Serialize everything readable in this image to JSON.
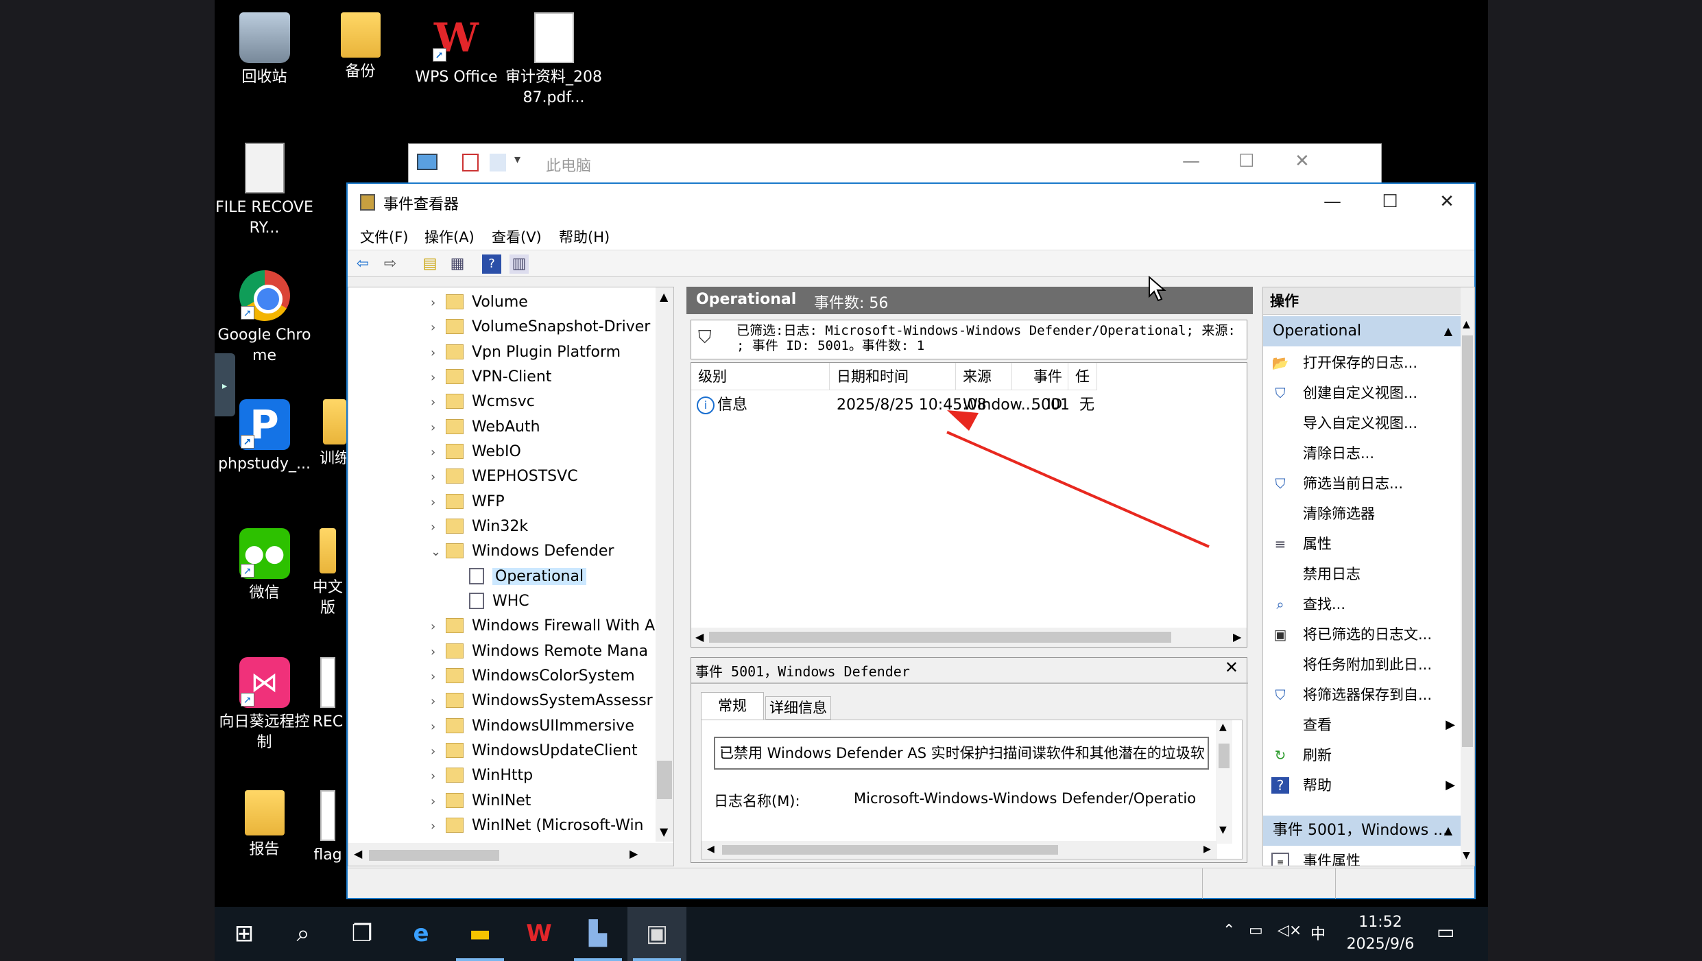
{
  "desktop": {
    "icons": [
      {
        "label": "回收站",
        "icon": "recycle-bin-icon"
      },
      {
        "label": "备份",
        "icon": "folder-icon"
      },
      {
        "label": "WPS Office",
        "icon": "wps-icon"
      },
      {
        "label": "审计资料_20887.pdf...",
        "icon": "document-icon"
      },
      {
        "label": "FILE RECOVERY...",
        "icon": "document-icon"
      },
      {
        "label": "Google Chrome",
        "icon": "chrome-icon"
      },
      {
        "label": "phpstudy_...",
        "icon": "phpstudy-icon"
      },
      {
        "label": "训练",
        "icon": "folder-icon"
      },
      {
        "label": "微信",
        "icon": "wechat-icon"
      },
      {
        "label": "中文版",
        "icon": "folder-icon"
      },
      {
        "label": "向日葵远程控制",
        "icon": "sunlogin-icon"
      },
      {
        "label": "REC",
        "icon": "document-icon"
      },
      {
        "label": "报告",
        "icon": "folder-icon"
      },
      {
        "label": "flag",
        "icon": "document-icon"
      }
    ]
  },
  "explorer": {
    "title": "此电脑"
  },
  "eventviewer": {
    "title": "事件查看器",
    "menu": [
      "文件(F)",
      "操作(A)",
      "查看(V)",
      "帮助(H)"
    ],
    "tree": [
      {
        "label": "Volume",
        "type": "folder",
        "expanded": false
      },
      {
        "label": "VolumeSnapshot-Driver",
        "type": "folder",
        "expanded": false
      },
      {
        "label": "Vpn Plugin Platform",
        "type": "folder",
        "expanded": false
      },
      {
        "label": "VPN-Client",
        "type": "folder",
        "expanded": false
      },
      {
        "label": "Wcmsvc",
        "type": "folder",
        "expanded": false
      },
      {
        "label": "WebAuth",
        "type": "folder",
        "expanded": false
      },
      {
        "label": "WebIO",
        "type": "folder",
        "expanded": false
      },
      {
        "label": "WEPHOSTSVC",
        "type": "folder",
        "expanded": false
      },
      {
        "label": "WFP",
        "type": "folder",
        "expanded": false
      },
      {
        "label": "Win32k",
        "type": "folder",
        "expanded": false
      },
      {
        "label": "Windows Defender",
        "type": "folder",
        "expanded": true
      },
      {
        "label": "Operational",
        "type": "log",
        "selected": true
      },
      {
        "label": "WHC",
        "type": "log"
      },
      {
        "label": "Windows Firewall With A",
        "type": "folder",
        "expanded": false
      },
      {
        "label": "Windows Remote Mana",
        "type": "folder",
        "expanded": false
      },
      {
        "label": "WindowsColorSystem",
        "type": "folder",
        "expanded": false
      },
      {
        "label": "WindowsSystemAssessr",
        "type": "folder",
        "expanded": false
      },
      {
        "label": "WindowsUIImmersive",
        "type": "folder",
        "expanded": false
      },
      {
        "label": "WindowsUpdateClient",
        "type": "folder",
        "expanded": false
      },
      {
        "label": "WinHttp",
        "type": "folder",
        "expanded": false
      },
      {
        "label": "WinINet",
        "type": "folder",
        "expanded": false
      },
      {
        "label": "WinINet (Microsoft-Win",
        "type": "folder",
        "expanded": false
      }
    ],
    "log_header": {
      "name": "Operational",
      "count": "事件数: 56"
    },
    "filter_line1": "已筛选:日志: Microsoft-Windows-Windows Defender/Operational; 来源:",
    "filter_line2": "; 事件 ID: 5001。事件数: 1",
    "columns": [
      "级别",
      "日期和时间",
      "来源",
      "事件 ID",
      "任务类"
    ],
    "rows": [
      {
        "level": "信息",
        "datetime": "2025/8/25 10:45:08",
        "source": "Window...",
        "event_id": "5001",
        "task": "无"
      }
    ],
    "detail": {
      "title": "事件 5001，Windows Defender",
      "tabs": [
        "常规",
        "详细信息"
      ],
      "message": "已禁用 Windows Defender AS 实时保护扫描间谍软件和其他潜在的垃圾软",
      "log_name_label": "日志名称(M):",
      "log_name_value": "Microsoft-Windows-Windows Defender/Operatio"
    },
    "actions_title": "操作",
    "action_section1": "Operational",
    "actions": [
      {
        "label": "打开保存的日志...",
        "icon": "open-log-icon"
      },
      {
        "label": "创建自定义视图...",
        "icon": "filter-icon"
      },
      {
        "label": "导入自定义视图...",
        "icon": ""
      },
      {
        "label": "清除日志...",
        "icon": ""
      },
      {
        "label": "筛选当前日志...",
        "icon": "filter-icon"
      },
      {
        "label": "清除筛选器",
        "icon": ""
      },
      {
        "label": "属性",
        "icon": "properties-icon"
      },
      {
        "label": "禁用日志",
        "icon": ""
      },
      {
        "label": "查找...",
        "icon": "find-icon"
      },
      {
        "label": "将已筛选的日志文...",
        "icon": "save-icon"
      },
      {
        "label": "将任务附加到此日...",
        "icon": ""
      },
      {
        "label": "将筛选器保存到自...",
        "icon": "save-filter-icon"
      },
      {
        "label": "查看",
        "icon": "",
        "submenu": true
      },
      {
        "label": "刷新",
        "icon": "refresh-icon"
      },
      {
        "label": "帮助",
        "icon": "help-icon",
        "submenu": true
      }
    ],
    "action_section2": "事件 5001，Windows ...",
    "actions2": [
      {
        "label": "事件属性",
        "icon": "properties-icon"
      }
    ]
  },
  "taskbar": {
    "time": "11:52",
    "date": "2025/9/6",
    "ime": "中"
  },
  "colors": {
    "accent": "#1979ca",
    "annotation_arrow": "#e8281f",
    "log_header": "#6d6d6d"
  }
}
